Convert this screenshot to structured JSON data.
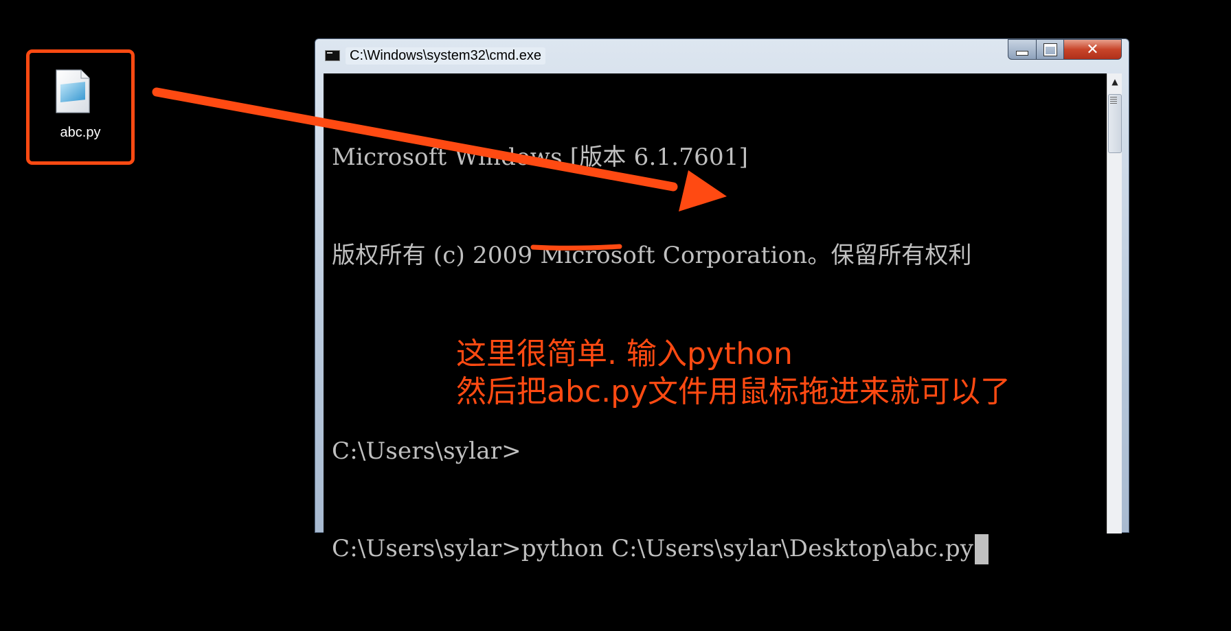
{
  "desktop_file": {
    "label": "abc.py",
    "icon": "python-file-icon"
  },
  "window": {
    "title": "C:\\Windows\\system32\\cmd.exe",
    "buttons": {
      "minimize": "minimize-icon",
      "maximize": "maximize-icon",
      "close": "✕"
    }
  },
  "console": {
    "lines": [
      "Microsoft Windows [版本 6.1.7601]",
      "版权所有 (c) 2009 Microsoft Corporation。保留所有权利",
      "",
      "C:\\Users\\sylar>",
      "C:\\Users\\sylar>python C:\\Users\\sylar\\Desktop\\abc.py"
    ]
  },
  "annotation": {
    "line1": "这里很简单. 输入python",
    "line2": "然后把abc.py文件用鼠标拖进来就可以了",
    "color": "#ff4a12"
  }
}
